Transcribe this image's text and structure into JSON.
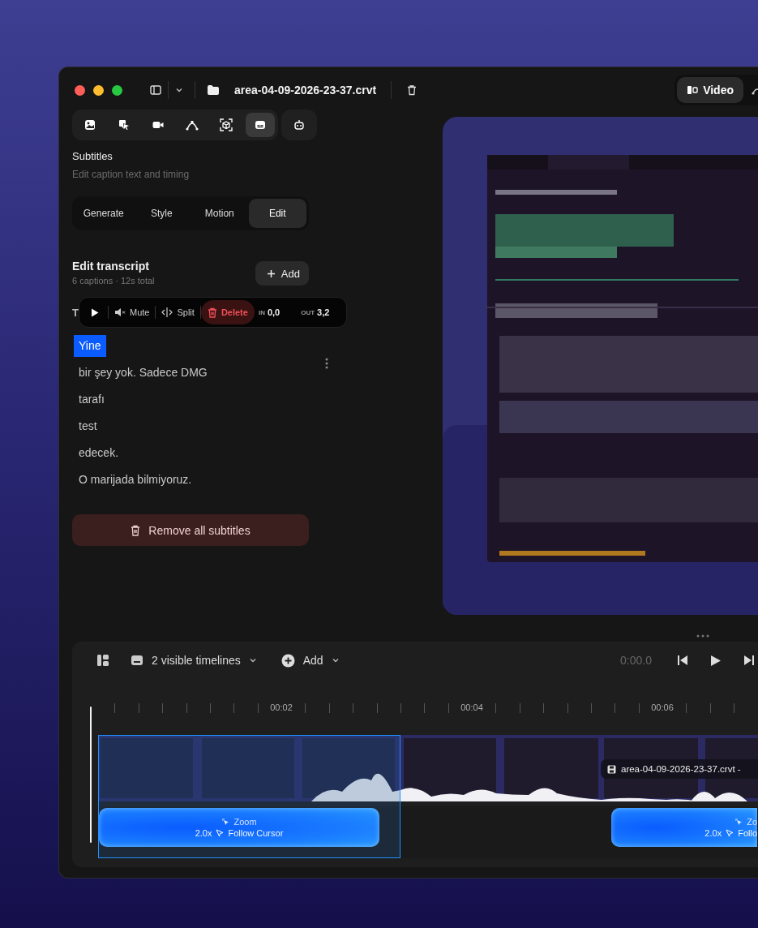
{
  "window": {
    "title": "area-04-09-2026-23-37.crvt"
  },
  "view_tabs": [
    {
      "label": "Video",
      "selected": true
    }
  ],
  "tools": [
    {
      "selected": false
    },
    {
      "selected": false
    },
    {
      "selected": false
    },
    {
      "selected": false
    },
    {
      "selected": false
    },
    {
      "selected": true
    },
    {
      "selected": false
    }
  ],
  "panel": {
    "title": "Subtitles",
    "subtitle": "Edit caption text and timing"
  },
  "mode_tabs": [
    {
      "label": "Generate",
      "selected": false
    },
    {
      "label": "Style",
      "selected": false
    },
    {
      "label": "Motion",
      "selected": false
    },
    {
      "label": "Edit",
      "selected": true
    }
  ],
  "transcript": {
    "title": "Edit transcript",
    "meta": "6 captions · 12s total",
    "add_button": "Add",
    "label": "T"
  },
  "caption_toolbar": {
    "mute": "Mute",
    "split": "Split",
    "delete": "Delete",
    "in_label": "IN",
    "in_value": "0,0",
    "out_label": "OUT",
    "out_value": "3,2"
  },
  "captions": [
    {
      "text": "Yine",
      "selected": true
    },
    {
      "text": "bir şey yok. Sadece DMG",
      "selected": false
    },
    {
      "text": "tarafı",
      "selected": false
    },
    {
      "text": "test",
      "selected": false
    },
    {
      "text": "edecek.",
      "selected": false
    },
    {
      "text": "O marijada bilmiyoruz.",
      "selected": false
    }
  ],
  "remove_button": "Remove all subtitles",
  "timeline": {
    "visible_button": "2 visible timelines",
    "add_button": "Add",
    "time": "0:00.0",
    "ruler_labels": [
      "00:02",
      "00:04",
      "00:06"
    ],
    "clip_label": "area-04-09-2026-23-37.crvt -",
    "zoom_clips": [
      {
        "title": "Zoom",
        "scale": "2.0x",
        "mode": "Follow Cursor",
        "selected": true
      },
      {
        "title": "Zo",
        "scale": "2.0x",
        "mode": "Follo",
        "selected": false
      }
    ]
  }
}
